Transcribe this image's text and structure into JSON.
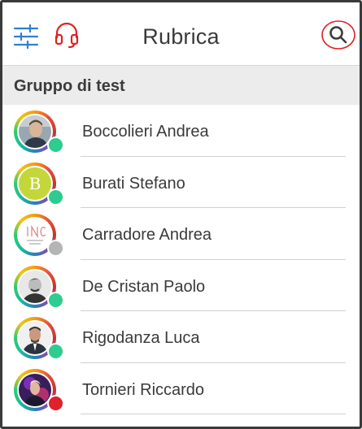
{
  "header": {
    "title": "Rubrica",
    "icons": [
      "sliders-icon",
      "headset-icon",
      "search-icon"
    ],
    "accent_color": "#2f7fd1",
    "alert_color": "#e02020"
  },
  "group": {
    "title": "Gruppo di test"
  },
  "contacts": [
    {
      "name": "Boccolieri Andrea",
      "avatar": "photo",
      "status": "online",
      "status_color": "#2ecc8f"
    },
    {
      "name": "Burati Stefano",
      "avatar": "letter",
      "initial": "B",
      "status": "online",
      "status_color": "#2ecc8f"
    },
    {
      "name": "Carradore Andrea",
      "avatar": "logo",
      "status": "offline",
      "status_color": "#b5b5b5"
    },
    {
      "name": "De Cristan Paolo",
      "avatar": "photo",
      "status": "online",
      "status_color": "#2ecc8f"
    },
    {
      "name": "Rigodanza Luca",
      "avatar": "photo",
      "status": "online",
      "status_color": "#2ecc8f"
    },
    {
      "name": "Tornieri Riccardo",
      "avatar": "photo",
      "status": "busy",
      "status_color": "#e0202a"
    }
  ]
}
